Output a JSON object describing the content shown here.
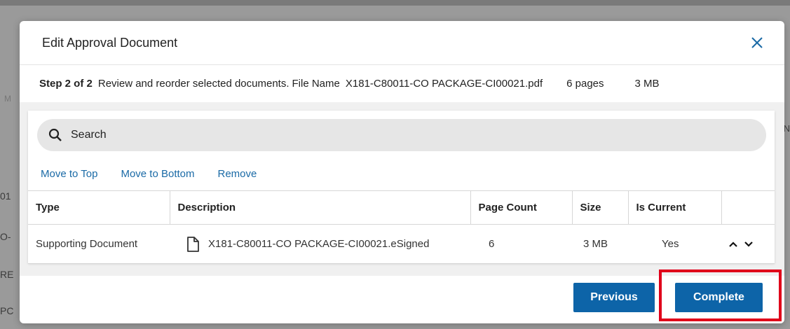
{
  "background": {
    "fragments": [
      "M",
      "01",
      "O-",
      "RE",
      "PC"
    ],
    "right_fragment": "N"
  },
  "modal": {
    "title": "Edit Approval Document",
    "close_icon": "close-icon"
  },
  "step_bar": {
    "step": "Step 2 of 2",
    "description": "Review and reorder selected documents.",
    "file_label": "File Name",
    "file_name": "X181-C80011-CO PACKAGE-CI00021.pdf",
    "pages": "6 pages",
    "size": "3 MB"
  },
  "search": {
    "placeholder": "Search",
    "value": ""
  },
  "actions": {
    "move_to_top": "Move to Top",
    "move_to_bottom": "Move to Bottom",
    "remove": "Remove"
  },
  "table": {
    "headers": {
      "type": "Type",
      "description": "Description",
      "page_count": "Page Count",
      "size": "Size",
      "is_current": "Is Current"
    },
    "rows": [
      {
        "type": "Supporting Document",
        "description": "X181-C80011-CO PACKAGE-CI00021.eSigned",
        "page_count": "6",
        "size": "3 MB",
        "is_current": "Yes"
      }
    ]
  },
  "footer": {
    "previous": "Previous",
    "complete": "Complete"
  },
  "colors": {
    "accent": "#0d64a8",
    "link": "#1a6aa6",
    "highlight": "#e0001a"
  }
}
